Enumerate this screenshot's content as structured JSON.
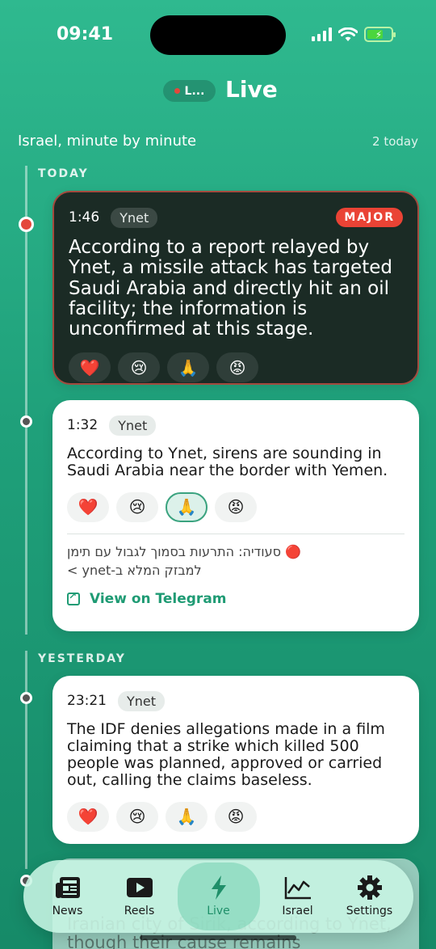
{
  "status_bar": {
    "time": "09:41"
  },
  "header": {
    "pill_label": "L...",
    "title": "Live"
  },
  "feed": {
    "subtitle": "Israel, minute by minute",
    "count": "2 today"
  },
  "sections": {
    "today": "TODAY",
    "yesterday": "YESTERDAY"
  },
  "cards": [
    {
      "time": "1:46",
      "source": "Ynet",
      "badge": "MAJOR",
      "text": "According to a report relayed by Ynet, a missile attack has targeted Saudi Arabia and directly hit an oil facility; the information is unconfirmed at this stage.",
      "reactions": [
        "❤️",
        "😢",
        "🙏",
        "😡"
      ]
    },
    {
      "time": "1:32",
      "source": "Ynet",
      "text": "According to Ynet, sirens are sounding in Saudi Arabia near the border with Yemen.",
      "reactions": [
        "❤️",
        "😢",
        "🙏",
        "😡"
      ],
      "original_line1": "🔴 סעודיה: התרעות בסמוך לגבול עם תימן",
      "original_line2": "למבזק המלא ב-ynet >",
      "link_label": "View on Telegram"
    },
    {
      "time": "23:21",
      "source": "Ynet",
      "text": "The IDF denies allegations made in a film claiming that a strike which killed 500 people was planned, approved or carried out, calling the claims baseless.",
      "reactions": [
        "❤️",
        "😢",
        "🙏",
        "😡"
      ]
    },
    {
      "text": "Iranian city of Sirik, according to Ynet, though their cause remains unconfirmed"
    }
  ],
  "tabbar": {
    "tabs": [
      {
        "label": "News",
        "icon": "newspaper-icon"
      },
      {
        "label": "Reels",
        "icon": "play-icon"
      },
      {
        "label": "Live",
        "icon": "bolt-icon"
      },
      {
        "label": "Israel",
        "icon": "chart-icon"
      },
      {
        "label": "Settings",
        "icon": "gear-icon"
      }
    ],
    "active": "Live"
  },
  "colors": {
    "accent": "#1f9b74",
    "major": "#ea4335",
    "background": "#1fa07a"
  }
}
